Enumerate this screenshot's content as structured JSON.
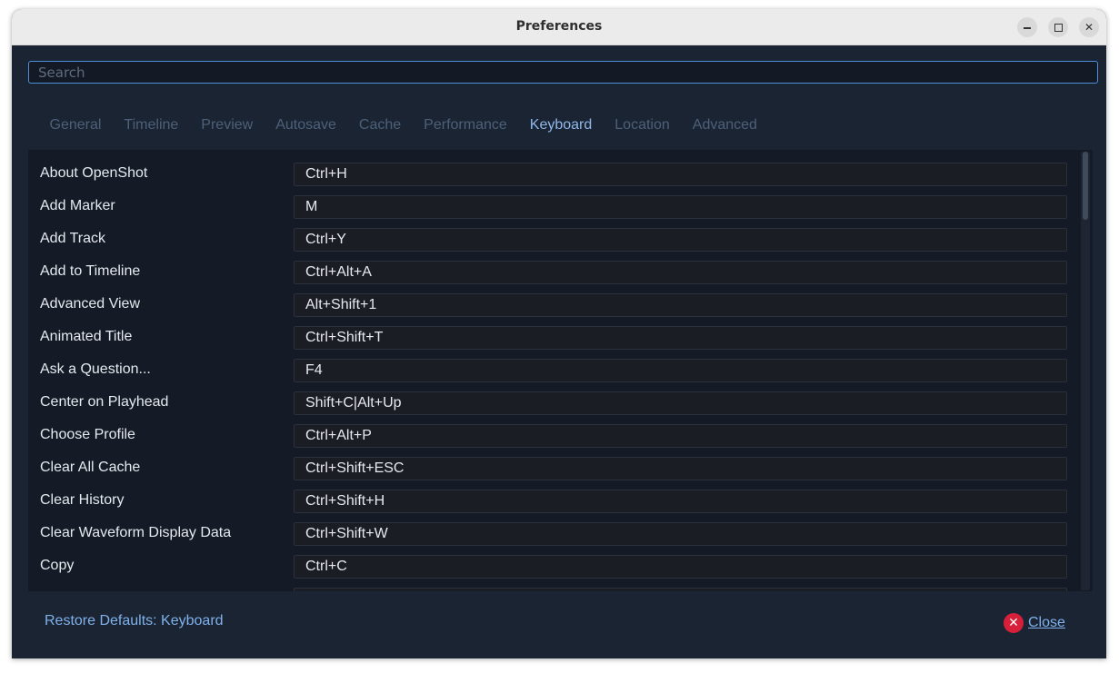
{
  "window": {
    "title": "Preferences",
    "controls": {
      "minimize": "minimize-icon",
      "maximize": "maximize-icon",
      "close": "close-icon"
    }
  },
  "search": {
    "placeholder": "Search",
    "value": ""
  },
  "tabs": [
    {
      "label": "General",
      "active": false
    },
    {
      "label": "Timeline",
      "active": false
    },
    {
      "label": "Preview",
      "active": false
    },
    {
      "label": "Autosave",
      "active": false
    },
    {
      "label": "Cache",
      "active": false
    },
    {
      "label": "Performance",
      "active": false
    },
    {
      "label": "Keyboard",
      "active": true
    },
    {
      "label": "Location",
      "active": false
    },
    {
      "label": "Advanced",
      "active": false
    }
  ],
  "shortcuts": [
    {
      "action": "About OpenShot",
      "keys": "Ctrl+H"
    },
    {
      "action": "Add Marker",
      "keys": "M"
    },
    {
      "action": "Add Track",
      "keys": "Ctrl+Y"
    },
    {
      "action": "Add to Timeline",
      "keys": "Ctrl+Alt+A"
    },
    {
      "action": "Advanced View",
      "keys": "Alt+Shift+1"
    },
    {
      "action": "Animated Title",
      "keys": "Ctrl+Shift+T"
    },
    {
      "action": "Ask a Question...",
      "keys": "F4"
    },
    {
      "action": "Center on Playhead",
      "keys": "Shift+C|Alt+Up"
    },
    {
      "action": "Choose Profile",
      "keys": "Ctrl+Alt+P"
    },
    {
      "action": "Clear All Cache",
      "keys": "Ctrl+Shift+ESC"
    },
    {
      "action": "Clear History",
      "keys": "Ctrl+Shift+H"
    },
    {
      "action": "Clear Waveform Display Data",
      "keys": "Ctrl+Shift+W"
    },
    {
      "action": "Copy",
      "keys": "Ctrl+C"
    },
    {
      "action": "",
      "keys": ""
    }
  ],
  "footer": {
    "restore_label": "Restore Defaults: Keyboard",
    "close_label": "Close"
  },
  "colors": {
    "accent": "#7fb1eb",
    "active_tab": "#8fb8e8",
    "inactive_tab": "#4d6079",
    "background": "#1b2433",
    "close_icon": "#d6203a"
  }
}
